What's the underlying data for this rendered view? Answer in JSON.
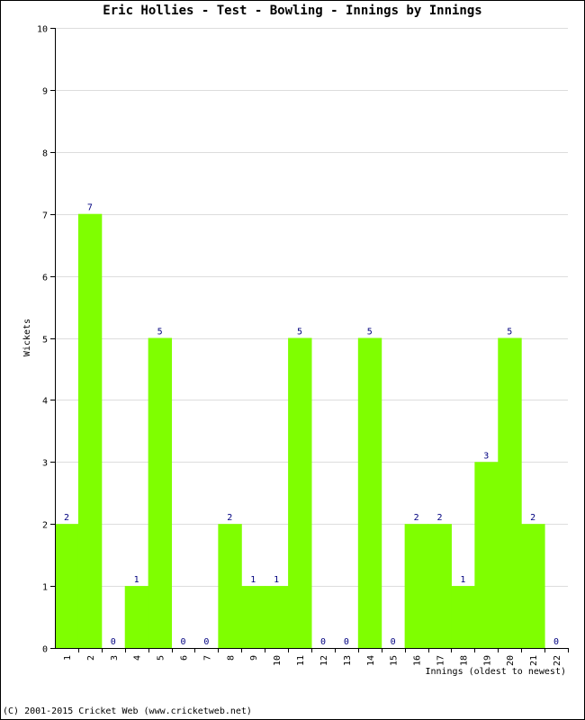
{
  "chart_data": {
    "type": "bar",
    "title": "Eric Hollies - Test - Bowling - Innings by Innings",
    "xlabel": "Innings (oldest to newest)",
    "ylabel": "Wickets",
    "ylim": [
      0,
      10
    ],
    "yticks": [
      "0",
      "1",
      "2",
      "3",
      "4",
      "5",
      "6",
      "7",
      "8",
      "9",
      "10"
    ],
    "categories": [
      "1",
      "2",
      "3",
      "4",
      "5",
      "6",
      "7",
      "8",
      "9",
      "10",
      "11",
      "12",
      "13",
      "14",
      "15",
      "16",
      "17",
      "18",
      "19",
      "20",
      "21",
      "22"
    ],
    "values": [
      2,
      7,
      0,
      1,
      5,
      0,
      0,
      2,
      1,
      1,
      5,
      0,
      0,
      5,
      0,
      2,
      2,
      1,
      3,
      5,
      2,
      0
    ],
    "grid": true,
    "bar_color": "#7fff00",
    "label_color": "#000080",
    "grid_color": "#dddddd"
  },
  "footer": {
    "copyright": "(C) 2001-2015 Cricket Web (www.cricketweb.net)"
  }
}
